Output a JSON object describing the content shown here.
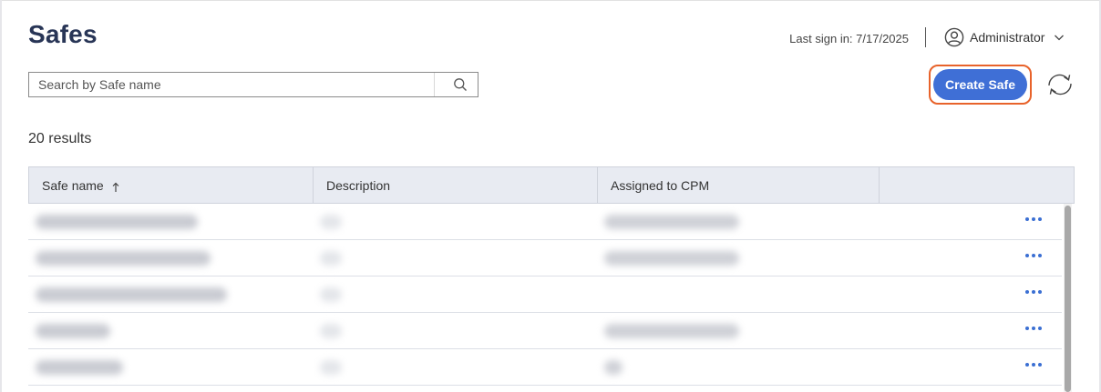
{
  "header": {
    "title": "Safes",
    "last_signin": "Last sign in: 7/17/2025",
    "user_name": "Administrator",
    "user_icon": "user-circle-icon",
    "chevron_icon": "chevron-down-icon"
  },
  "search": {
    "placeholder": "Search by Safe name",
    "value": "",
    "icon": "search-icon"
  },
  "actions": {
    "create_label": "Create Safe",
    "refresh_icon": "refresh-icon",
    "create_color": "#3f6fd6",
    "highlight_color": "#e8632b"
  },
  "results": {
    "label": "20 results"
  },
  "table": {
    "columns": [
      "Safe name",
      "Description",
      "Assigned to CPM",
      ""
    ],
    "sort_column": "Safe name",
    "sort_direction": "ascending",
    "rows_visible": 5,
    "row_action_icon": "more-horizontal-icon",
    "note": ""
  }
}
